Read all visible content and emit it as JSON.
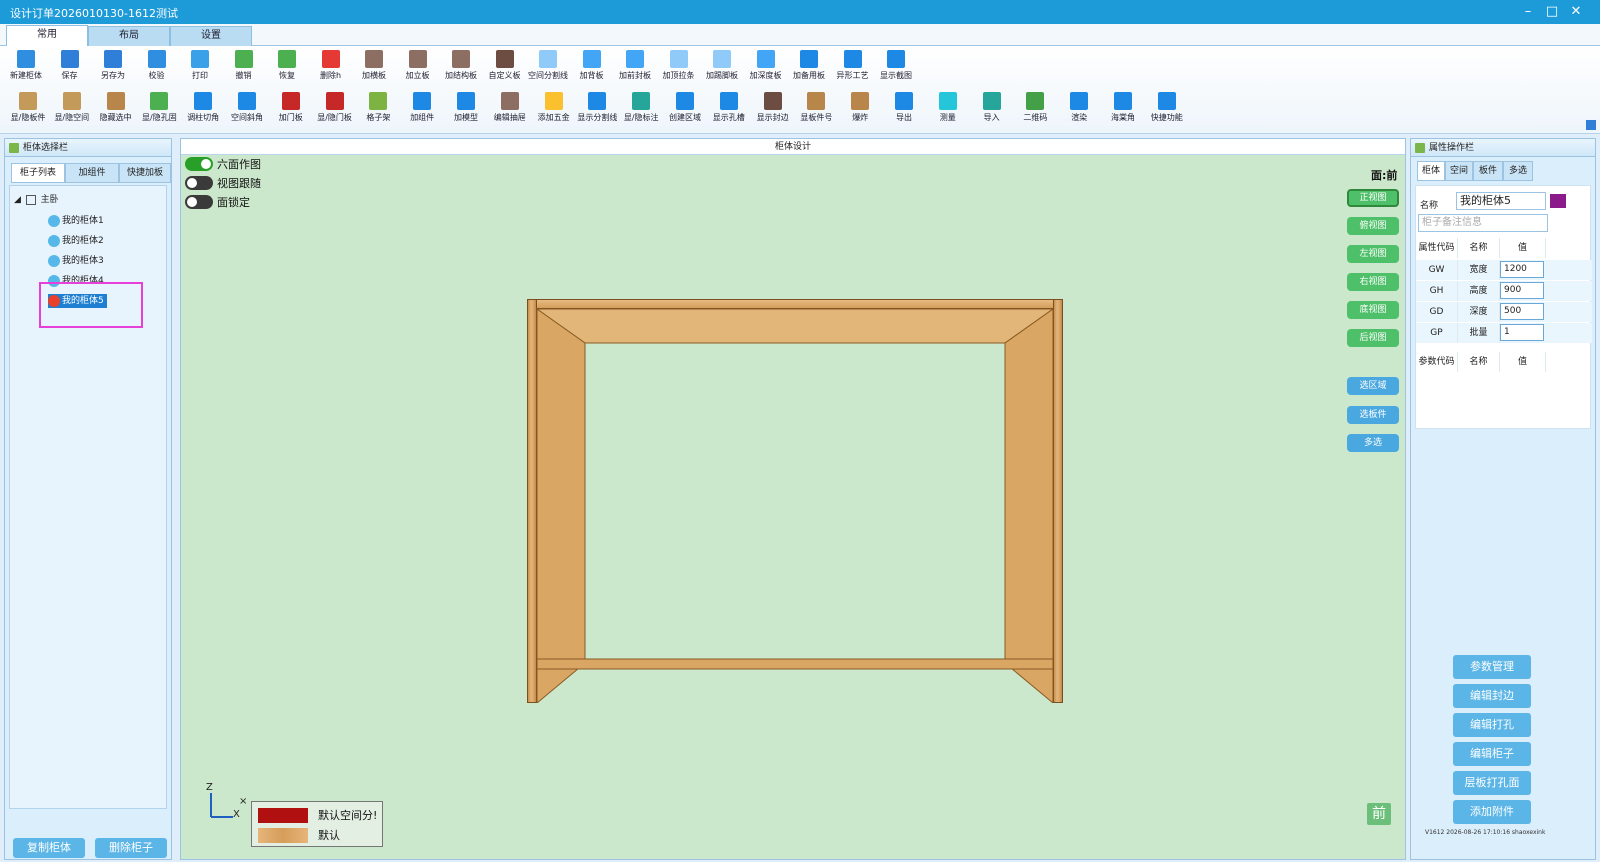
{
  "window": {
    "title": "设计订单2026010130-1612测试",
    "controls": [
      "–",
      "□",
      "✕"
    ]
  },
  "ribbon_tabs": [
    "常用",
    "布局",
    "设置"
  ],
  "toolbar_row1": [
    {
      "label": "新建柜体",
      "icon": "new-cabinet-icon",
      "color": "#2f8ee0"
    },
    {
      "label": "保存",
      "icon": "save-icon",
      "color": "#2f7fd8"
    },
    {
      "label": "另存为",
      "icon": "save-as-icon",
      "color": "#2f7fd8"
    },
    {
      "label": "校验",
      "icon": "verify-icon",
      "color": "#2f8ee0"
    },
    {
      "label": "打印",
      "icon": "print-icon",
      "color": "#3aa0e8"
    },
    {
      "label": "撤销",
      "icon": "undo-icon",
      "color": "#4caf50"
    },
    {
      "label": "恢复",
      "icon": "redo-icon",
      "color": "#4caf50"
    },
    {
      "label": "删除h",
      "icon": "delete-icon",
      "color": "#e53935"
    },
    {
      "label": "加横板",
      "icon": "add-horizontal-board-icon",
      "color": "#8d6e63"
    },
    {
      "label": "加立板",
      "icon": "add-vertical-board-icon",
      "color": "#8d6e63"
    },
    {
      "label": "加结构板",
      "icon": "add-structure-board-icon",
      "color": "#8d6e63"
    },
    {
      "label": "自定义板",
      "icon": "custom-board-icon",
      "color": "#6d4c41"
    },
    {
      "label": "空间分割线",
      "icon": "space-divider-icon",
      "color": "#90caf9"
    },
    {
      "label": "加背板",
      "icon": "add-back-board-icon",
      "color": "#42a5f5"
    },
    {
      "label": "加前封板",
      "icon": "add-front-seal-icon",
      "color": "#42a5f5"
    },
    {
      "label": "加顶拉条",
      "icon": "add-top-rail-icon",
      "color": "#90caf9"
    },
    {
      "label": "加踢脚板",
      "icon": "add-kick-board-icon",
      "color": "#90caf9"
    },
    {
      "label": "加深度板",
      "icon": "add-depth-board-icon",
      "color": "#42a5f5"
    },
    {
      "label": "加备用板",
      "icon": "add-spare-board-icon",
      "color": "#1e88e5"
    },
    {
      "label": "异形工艺",
      "icon": "special-craft-icon",
      "color": "#1e88e5"
    },
    {
      "label": "显示截图",
      "icon": "screenshot-icon",
      "color": "#1e88e5"
    }
  ],
  "toolbar_row2": [
    {
      "label": "显/隐板件",
      "icon": "toggle-boards-icon",
      "color": "#c49a5a"
    },
    {
      "label": "显/隐空间",
      "icon": "toggle-space-icon",
      "color": "#c49a5a"
    },
    {
      "label": "隐藏选中",
      "icon": "hide-selected-icon",
      "color": "#b8864b"
    },
    {
      "label": "显/隐孔固",
      "icon": "toggle-holes-icon",
      "color": "#4caf50"
    },
    {
      "label": "调柱切角",
      "icon": "column-cut-icon",
      "color": "#1e88e5"
    },
    {
      "label": "空间斜角",
      "icon": "space-bevel-icon",
      "color": "#1e88e5"
    },
    {
      "label": "加门板",
      "icon": "add-door-icon",
      "color": "#c62828"
    },
    {
      "label": "显/隐门板",
      "icon": "toggle-door-icon",
      "color": "#c62828"
    },
    {
      "label": "格子架",
      "icon": "grid-rack-icon",
      "color": "#7cb342"
    },
    {
      "label": "加组件",
      "icon": "add-component-icon",
      "color": "#1e88e5"
    },
    {
      "label": "加模型",
      "icon": "add-model-icon",
      "color": "#1e88e5"
    },
    {
      "label": "编辑抽屉",
      "icon": "edit-drawer-icon",
      "color": "#8d6e63"
    },
    {
      "label": "添加五金",
      "icon": "add-hardware-icon",
      "color": "#fbc02d"
    },
    {
      "label": "显示分割线",
      "icon": "show-divider-icon",
      "color": "#1e88e5"
    },
    {
      "label": "显/隐标注",
      "icon": "toggle-annotation-icon",
      "color": "#26a69a"
    },
    {
      "label": "创建区域",
      "icon": "create-region-icon",
      "color": "#1e88e5"
    },
    {
      "label": "显示孔槽",
      "icon": "show-slot-icon",
      "color": "#1e88e5"
    },
    {
      "label": "显示封边",
      "icon": "show-edge-icon",
      "color": "#6d4c41"
    },
    {
      "label": "显板件号",
      "icon": "show-board-number-icon",
      "color": "#b8864b"
    },
    {
      "label": "爆炸",
      "icon": "explode-icon",
      "color": "#b8864b"
    },
    {
      "label": "导出",
      "icon": "export-icon",
      "color": "#1e88e5"
    },
    {
      "label": "测量",
      "icon": "measure-icon",
      "color": "#26c6da"
    },
    {
      "label": "导入",
      "icon": "import-icon",
      "color": "#26a69a"
    },
    {
      "label": "二维码",
      "icon": "qrcode-icon",
      "color": "#43a047"
    },
    {
      "label": "渲染",
      "icon": "render-icon",
      "color": "#1e88e5"
    },
    {
      "label": "海棠角",
      "icon": "begonia-corner-icon",
      "color": "#1e88e5"
    },
    {
      "label": "快捷功能",
      "icon": "quick-function-icon",
      "color": "#1e88e5"
    }
  ],
  "left_panel": {
    "title": "柜体选择栏",
    "tabs": [
      "柜子列表",
      "加组件",
      "快捷加板"
    ],
    "tree_root": "主卧",
    "cabinets": [
      "我的柜体1",
      "我的柜体2",
      "我的柜体3",
      "我的柜体4",
      "我的柜体5"
    ],
    "selected": "我的柜体5",
    "copy_button": "复制柜体",
    "delete_button": "删除柜子"
  },
  "center_panel": {
    "title": "柜体设计",
    "toggles": [
      {
        "label": "六面作图",
        "on": true
      },
      {
        "label": "视图跟随",
        "on": false
      },
      {
        "label": "面锁定",
        "on": false
      }
    ],
    "face_label": "面:前",
    "view_buttons": [
      "正视图",
      "俯视图",
      "左视图",
      "右视图",
      "底视图",
      "后视图"
    ],
    "select_buttons": [
      "选区域",
      "选板件",
      "多选"
    ],
    "legend": [
      {
        "label": "默认空间分!",
        "color": "#b01010"
      },
      {
        "label": "默认",
        "color": "#e0a86a"
      }
    ],
    "axes": {
      "z": "Z",
      "x": "X",
      "y": "×"
    },
    "front_indicator": "前"
  },
  "right_panel": {
    "title": "属性操作栏",
    "tabs": [
      "柜体",
      "空间",
      "板件",
      "多选"
    ],
    "name_label": "名称",
    "name_value": "我的柜体5",
    "note_placeholder": "柜子备注信息",
    "swatch_color": "#8b1a8b",
    "attr_headers": [
      "属性代码",
      "名称",
      "值"
    ],
    "attributes": [
      {
        "code": "GW",
        "name": "宽度",
        "value": "1200"
      },
      {
        "code": "GH",
        "name": "高度",
        "value": "900"
      },
      {
        "code": "GD",
        "name": "深度",
        "value": "500"
      },
      {
        "code": "GP",
        "name": "批量",
        "value": "1"
      }
    ],
    "param_headers": [
      "参数代码",
      "名称",
      "值"
    ],
    "buttons": [
      "参数管理",
      "编辑封边",
      "编辑打孔",
      "编辑柜子",
      "层板打孔面",
      "添加附件"
    ],
    "version": "V1612 2026-08-26 17:10:16 shaoxexink"
  }
}
